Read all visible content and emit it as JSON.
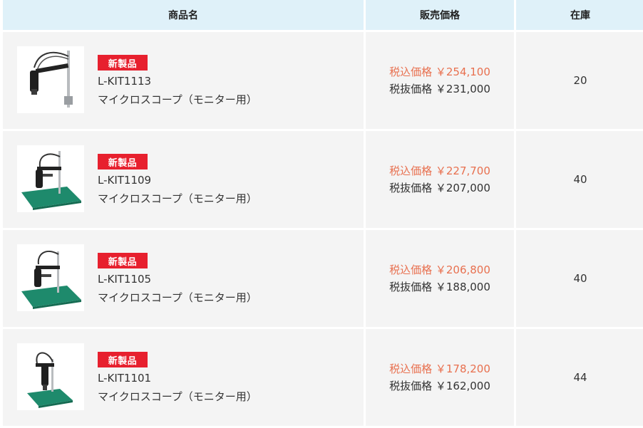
{
  "header": {
    "product_col": "商品名",
    "price_col": "販売価格",
    "stock_col": "在庫"
  },
  "colors": {
    "header_bg": "#dff1f9",
    "cell_bg": "#f4f4f4",
    "badge_bg": "#e7202e",
    "tax_incl_price": "#e8704f"
  },
  "rows": [
    {
      "badge": "新製品",
      "code": "L-KIT1113",
      "name": "マイクロスコープ（モニター用）",
      "price_incl": "税込価格 ￥254,100",
      "price_excl": "税抜価格 ￥231,000",
      "stock": "20",
      "image": "microscope-arm-stand-image"
    },
    {
      "badge": "新製品",
      "code": "L-KIT1109",
      "name": "マイクロスコープ（モニター用）",
      "price_incl": "税込価格 ￥227,700",
      "price_excl": "税抜価格 ￥207,000",
      "stock": "40",
      "image": "microscope-base-stand-image"
    },
    {
      "badge": "新製品",
      "code": "L-KIT1105",
      "name": "マイクロスコープ（モニター用）",
      "price_incl": "税込価格 ￥206,800",
      "price_excl": "税抜価格 ￥188,000",
      "stock": "40",
      "image": "microscope-base-stand-image"
    },
    {
      "badge": "新製品",
      "code": "L-KIT1101",
      "name": "マイクロスコープ（モニター用）",
      "price_incl": "税込価格 ￥178,200",
      "price_excl": "税抜価格 ￥162,000",
      "stock": "44",
      "image": "microscope-base-stand-image"
    }
  ]
}
